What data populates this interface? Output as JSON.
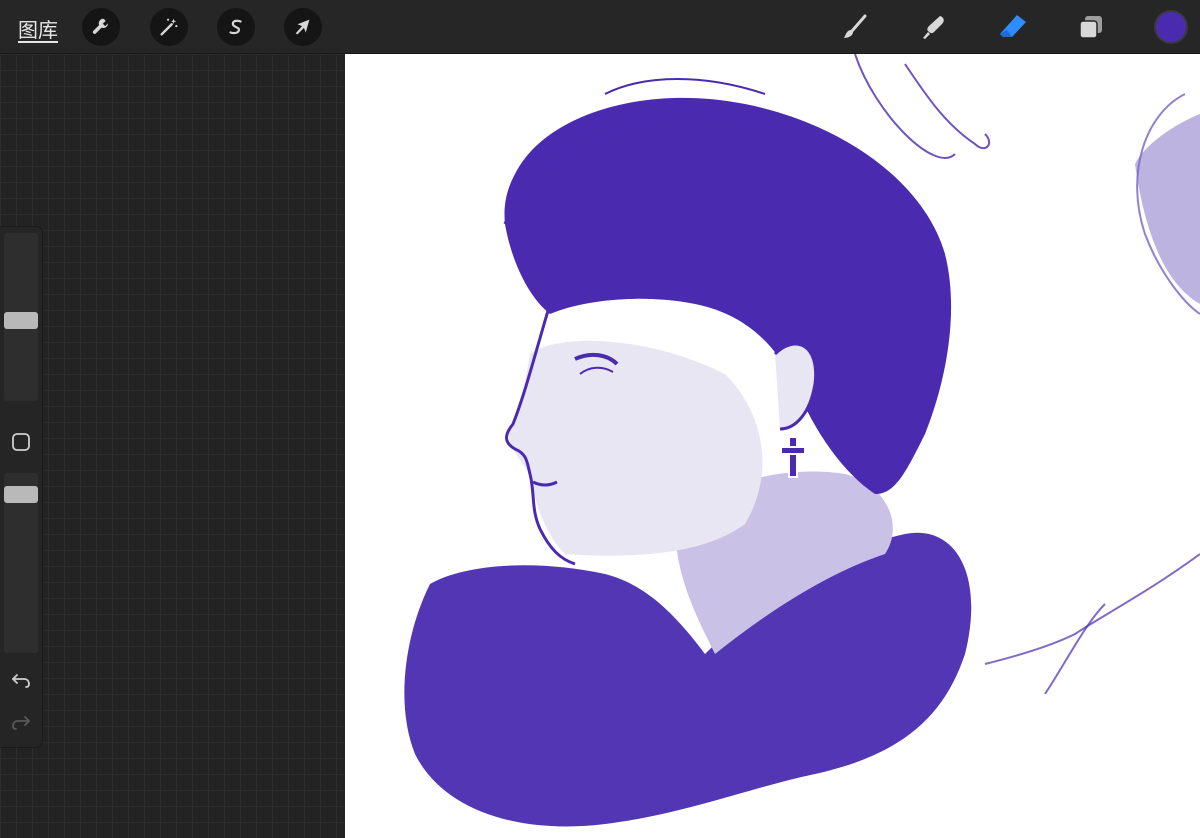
{
  "app": {
    "gallery_label": "图库"
  },
  "toolbar": {
    "left_tools": [
      {
        "icon": "wrench-icon",
        "name": "actions"
      },
      {
        "icon": "magic-wand-icon",
        "name": "adjustments"
      },
      {
        "icon": "selection-s-icon",
        "name": "selection"
      },
      {
        "icon": "arrow-cursor-icon",
        "name": "transform"
      }
    ],
    "right_tools": [
      {
        "icon": "brush-icon",
        "name": "paint"
      },
      {
        "icon": "smudge-icon",
        "name": "smudge"
      },
      {
        "icon": "eraser-icon",
        "name": "erase",
        "active": true
      },
      {
        "icon": "layers-icon",
        "name": "layers"
      }
    ],
    "active_color": "#4a2bb0",
    "accent_color": "#2f8cff"
  },
  "sidebar": {
    "brush_size_level": 0.48,
    "opacity_level": 0.08,
    "modify_icon": "square-outline-icon",
    "undo_icon": "undo-icon",
    "redo_icon": "redo-icon"
  },
  "canvas": {
    "drawing_color": "#4a2bb0",
    "background": "#ffffff"
  }
}
